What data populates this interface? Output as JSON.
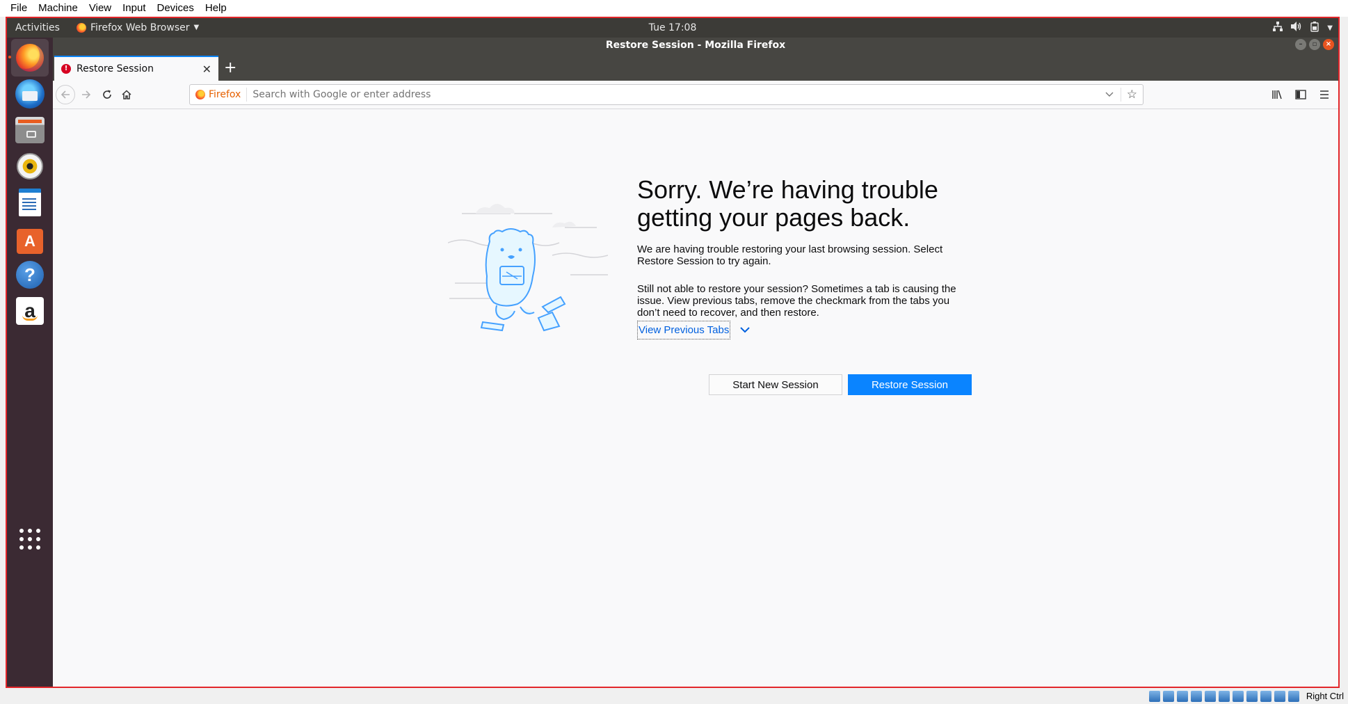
{
  "host_menu": [
    "File",
    "Machine",
    "View",
    "Input",
    "Devices",
    "Help"
  ],
  "topbar": {
    "activities": "Activities",
    "app_name": "Firefox Web Browser",
    "clock": "Tue 17:08"
  },
  "window": {
    "title": "Restore Session - Mozilla Firefox"
  },
  "tab": {
    "title": "Restore Session"
  },
  "urlbar": {
    "identity_label": "Firefox",
    "placeholder": "Search with Google or enter address"
  },
  "content": {
    "title": "Sorry. We’re having trouble getting your pages back.",
    "para1": "We are having trouble restoring your last browsing session. Select Restore Session to try again.",
    "para2": "Still not able to restore your session? Sometimes a tab is causing the issue. View previous tabs, remove the checkmark from the tabs you don’t need to recover, and then restore.",
    "view_tabs_label": "View Previous Tabs",
    "new_session_label": "Start New Session",
    "restore_label": "Restore Session"
  },
  "dock": {
    "icons": [
      "firefox-icon",
      "thunderbird-icon",
      "files-icon",
      "rhythmbox-icon",
      "libreoffice-writer-icon",
      "software-center-icon",
      "help-icon",
      "amazon-icon",
      "show-applications-icon"
    ]
  },
  "statusbar": {
    "host_key": "Right Ctrl"
  },
  "colors": {
    "accent": "#0a84ff",
    "vm_border": "#e3262a",
    "ubuntu_topbar": "#3c3b37",
    "dock": "#3b2a33"
  }
}
